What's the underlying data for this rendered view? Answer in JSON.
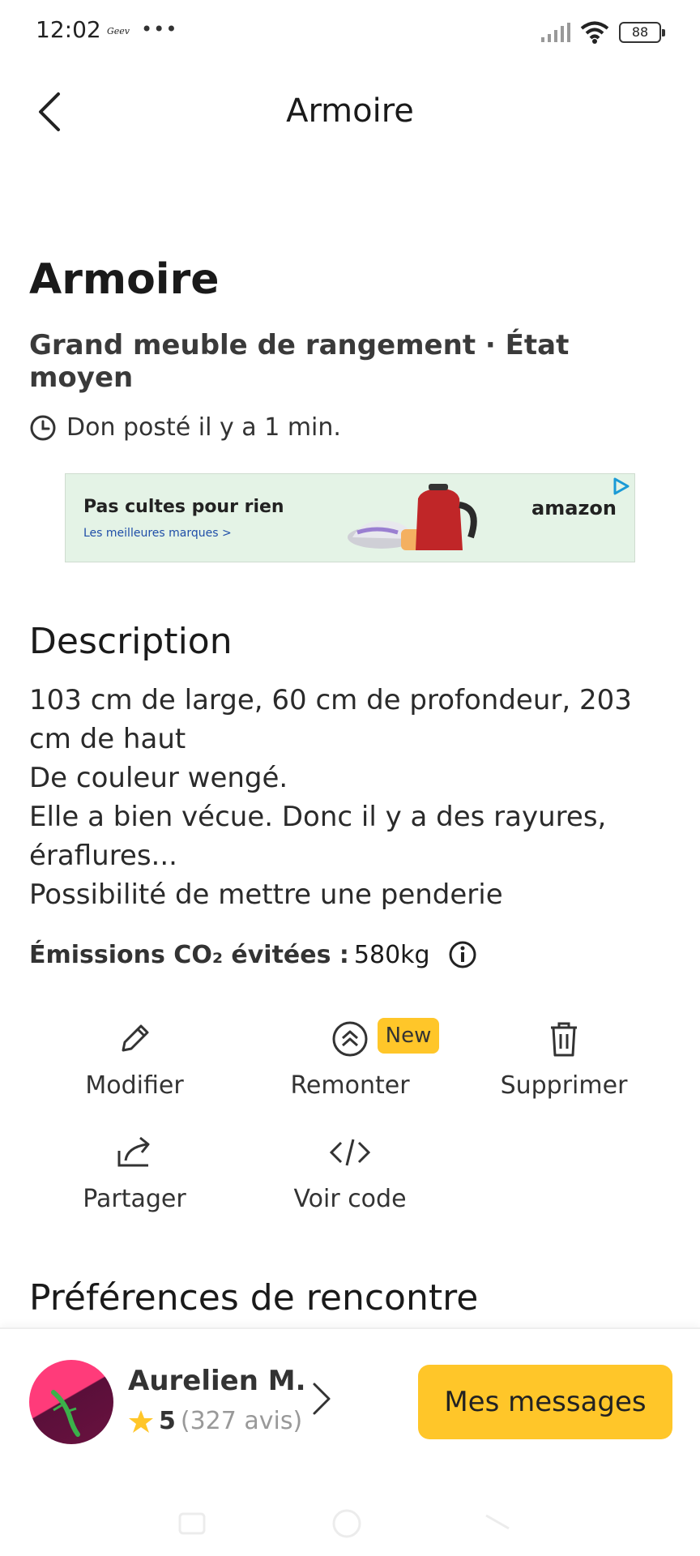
{
  "status_bar": {
    "time": "12:02",
    "app_label": "Geev",
    "dots": "•••",
    "battery": "88"
  },
  "topbar": {
    "title": "Armoire"
  },
  "item": {
    "title": "Armoire",
    "subtitle": "Grand meuble de rangement · État moyen",
    "posted": "Don posté il y a 1 min."
  },
  "ad": {
    "title": "Pas cultes pour rien",
    "subtitle": "Les meilleures marques >",
    "brand": "amazon"
  },
  "description": {
    "heading": "Description",
    "body": "103 cm de large, 60 cm de profondeur, 203 cm de haut\nDe couleur wengé.\nElle a bien vécue. Donc il y a des rayures, éraflures...\nPossibilité de mettre une penderie"
  },
  "emissions": {
    "label": "Émissions CO₂ évitées :",
    "value": "580kg"
  },
  "actions": {
    "edit": "Modifier",
    "boost": "Remonter",
    "boost_badge": "New",
    "delete": "Supprimer",
    "share": "Partager",
    "code": "Voir code"
  },
  "prefs": {
    "heading": "Préférences de rencontre"
  },
  "user": {
    "name": "Aurelien M.",
    "score": "5",
    "reviews": "(327 avis)"
  },
  "messages_button": "Mes messages",
  "colors": {
    "accent": "#ffc629",
    "text": "#1a1a1a",
    "ad_bg": "#e4f3e6"
  }
}
